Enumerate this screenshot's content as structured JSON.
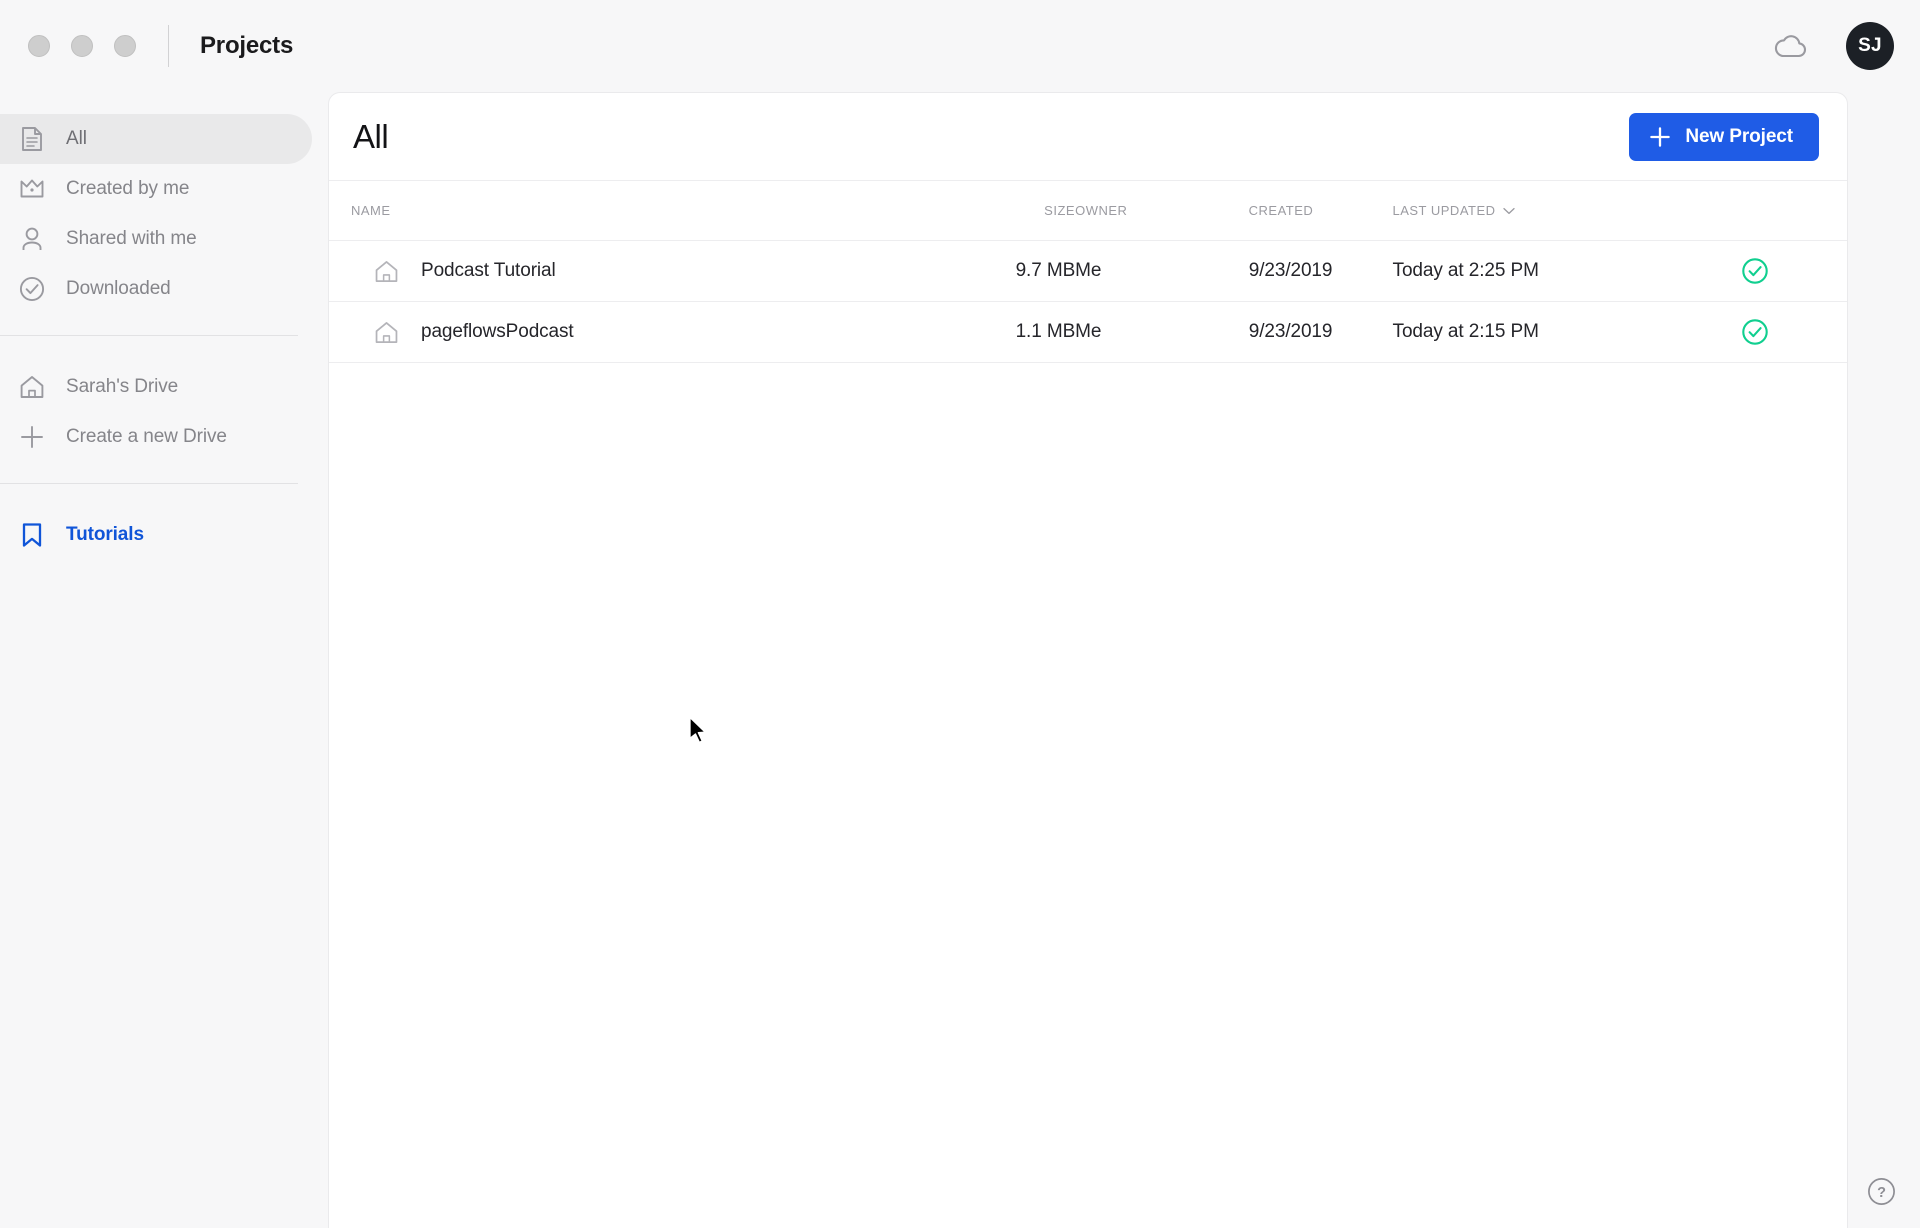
{
  "titlebar": {
    "title": "Projects",
    "traffic_lights": [
      "close",
      "minimize",
      "maximize"
    ],
    "cloud_icon": "cloud-icon",
    "avatar_initials": "SJ"
  },
  "sidebar": {
    "groups": [
      {
        "items": [
          {
            "label": "All",
            "icon": "document-icon",
            "selected": true
          },
          {
            "label": "Created by me",
            "icon": "crown-icon",
            "selected": false
          },
          {
            "label": "Shared with me",
            "icon": "person-icon",
            "selected": false
          },
          {
            "label": "Downloaded",
            "icon": "check-circle-icon",
            "selected": false
          }
        ]
      },
      {
        "items": [
          {
            "label": "Sarah's Drive",
            "icon": "home-icon",
            "selected": false
          },
          {
            "label": "Create a new Drive",
            "icon": "plus-icon",
            "selected": false
          }
        ]
      },
      {
        "items": [
          {
            "label": "Tutorials",
            "icon": "bookmark-icon",
            "selected": false,
            "accent": true
          }
        ]
      }
    ]
  },
  "main": {
    "title": "All",
    "new_project_label": "New Project",
    "new_project_icon": "plus-icon",
    "accent_color": "#1f5ce6",
    "status_color": "#10cf8f",
    "table": {
      "columns": [
        {
          "key": "name",
          "label": "Name",
          "sorted": false
        },
        {
          "key": "size",
          "label": "Size",
          "sorted": false
        },
        {
          "key": "owner",
          "label": "Owner",
          "sorted": false
        },
        {
          "key": "created",
          "label": "Created",
          "sorted": false
        },
        {
          "key": "updated",
          "label": "Last Updated",
          "sorted": true,
          "sort_icon": "chevron-down-icon"
        }
      ],
      "rows": [
        {
          "icon": "home-icon",
          "name": "Podcast Tutorial",
          "size": "9.7 MB",
          "owner": "Me",
          "created": "9/23/2019",
          "updated": "Today at 2:25 PM",
          "status": "synced"
        },
        {
          "icon": "home-icon",
          "name": "pageflowsPodcast",
          "size": "1.1 MB",
          "owner": "Me",
          "created": "9/23/2019",
          "updated": "Today at 2:15 PM",
          "status": "synced"
        }
      ]
    }
  },
  "help": {
    "icon": "question-circle-icon",
    "label": "?"
  }
}
